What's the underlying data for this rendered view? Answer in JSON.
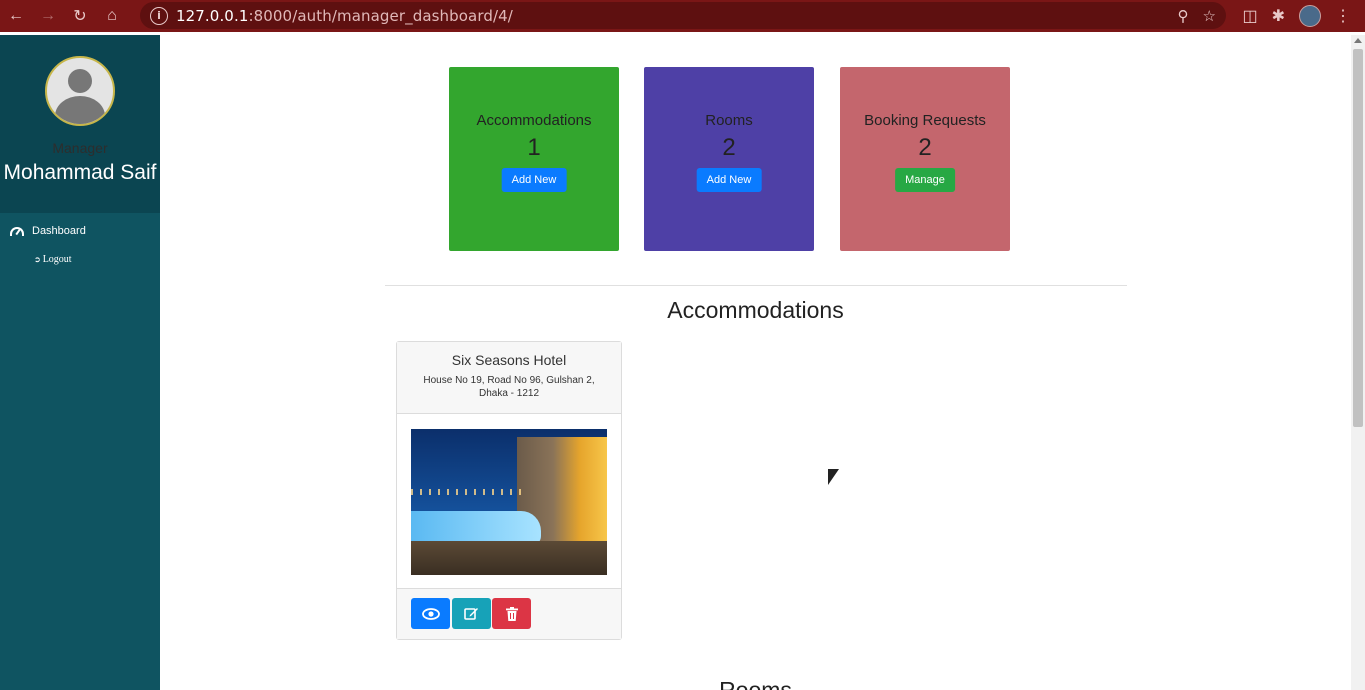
{
  "browser": {
    "url_host": "127.0.0.1",
    "url_path": ":8000/auth/manager_dashboard/4/"
  },
  "sidebar": {
    "role": "Manager",
    "user_name": "Mohammad Saif",
    "items": [
      {
        "label": "Dashboard",
        "icon": "tachometer-icon"
      },
      {
        "label": "Logout",
        "icon": "sign-out-icon"
      }
    ]
  },
  "stats": [
    {
      "label": "Accommodations",
      "value": "1",
      "button": "Add New",
      "color": "#33a62e"
    },
    {
      "label": "Rooms",
      "value": "2",
      "button": "Add New",
      "color": "#4e40a6"
    },
    {
      "label": "Booking Requests",
      "value": "2",
      "button": "Manage",
      "color": "#c4666d"
    }
  ],
  "sections": {
    "accommodations_title": "Accommodations",
    "rooms_title": "Rooms"
  },
  "accommodation": {
    "name": "Six Seasons Hotel",
    "address": "House No 19, Road No 96, Gulshan 2, Dhaka - 1212",
    "actions": [
      {
        "icon": "eye-icon"
      },
      {
        "icon": "edit-icon"
      },
      {
        "icon": "trash-icon"
      }
    ]
  },
  "colors": {
    "sidebar": "#0f5461",
    "browser_bar": "#7a1616",
    "primary": "#0a7bff",
    "info": "#17a2b8",
    "danger": "#dc3545",
    "success": "#27a844"
  }
}
